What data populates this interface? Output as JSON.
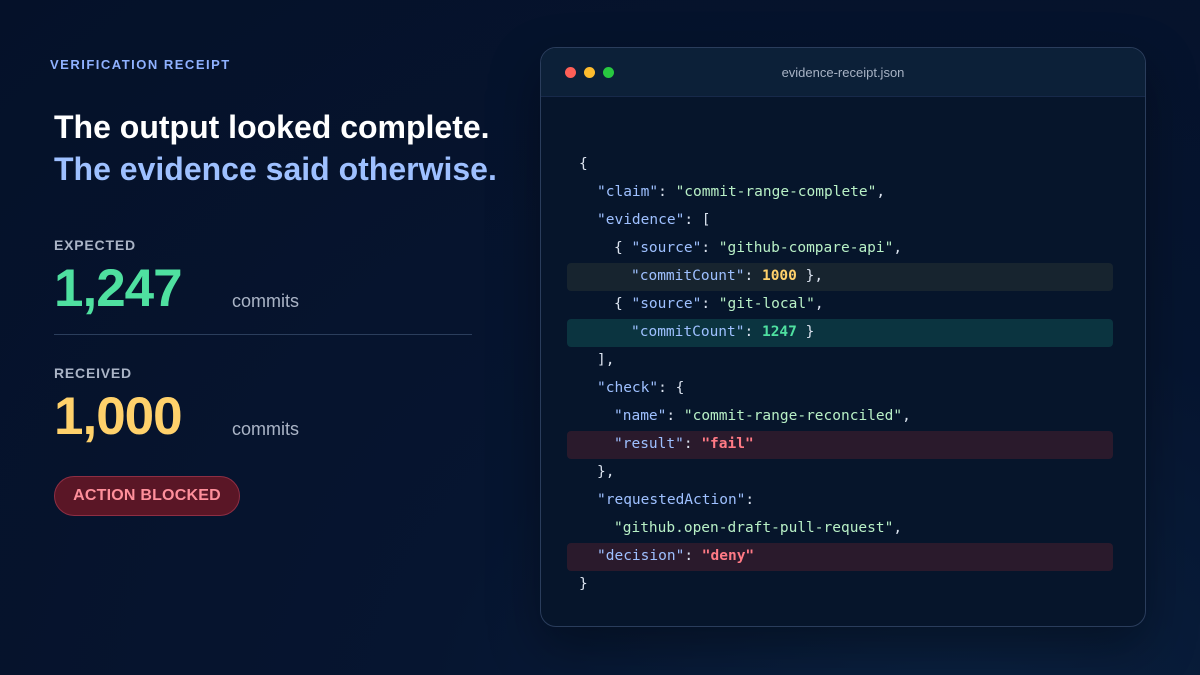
{
  "eyebrow": "VERIFICATION RECEIPT",
  "headline": {
    "line1": "The output looked complete.",
    "line2": "The evidence said otherwise."
  },
  "expected": {
    "label": "EXPECTED",
    "value": "1,247",
    "unit": "commits"
  },
  "received": {
    "label": "RECEIVED",
    "value": "1,000",
    "unit": "commits"
  },
  "badge": "ACTION BLOCKED",
  "colors": {
    "expected": "#4fe0a0",
    "received": "#ffd16b",
    "blocked": "#ff8f9b",
    "key": "#9ec0ff"
  },
  "window": {
    "filename": "evidence-receipt.json",
    "controls": [
      "close",
      "minimize",
      "zoom"
    ]
  },
  "code": {
    "open_brace": "{",
    "claim_key": "\"claim\"",
    "claim_value": "\"commit-range-complete\"",
    "evidence_key": "\"evidence\"",
    "evidence_open": "[",
    "source_key": "\"source\"",
    "source1_value": "\"github-compare-api\"",
    "commitcount_key": "\"commitCount\"",
    "commitcount1_value": "1000",
    "source2_value": "\"git-local\"",
    "commitcount2_value": "1247",
    "evidence_close": "],",
    "check_key": "\"check\"",
    "name_key": "\"name\"",
    "name_value": "\"commit-range-reconciled\"",
    "result_key": "\"result\"",
    "result_value": "\"fail\"",
    "check_close": "},",
    "requested_key": "\"requestedAction\"",
    "requested_value": "\"github.open-draft-pull-request\"",
    "decision_key": "\"decision\"",
    "decision_value": "\"deny\"",
    "close_brace": "}"
  }
}
